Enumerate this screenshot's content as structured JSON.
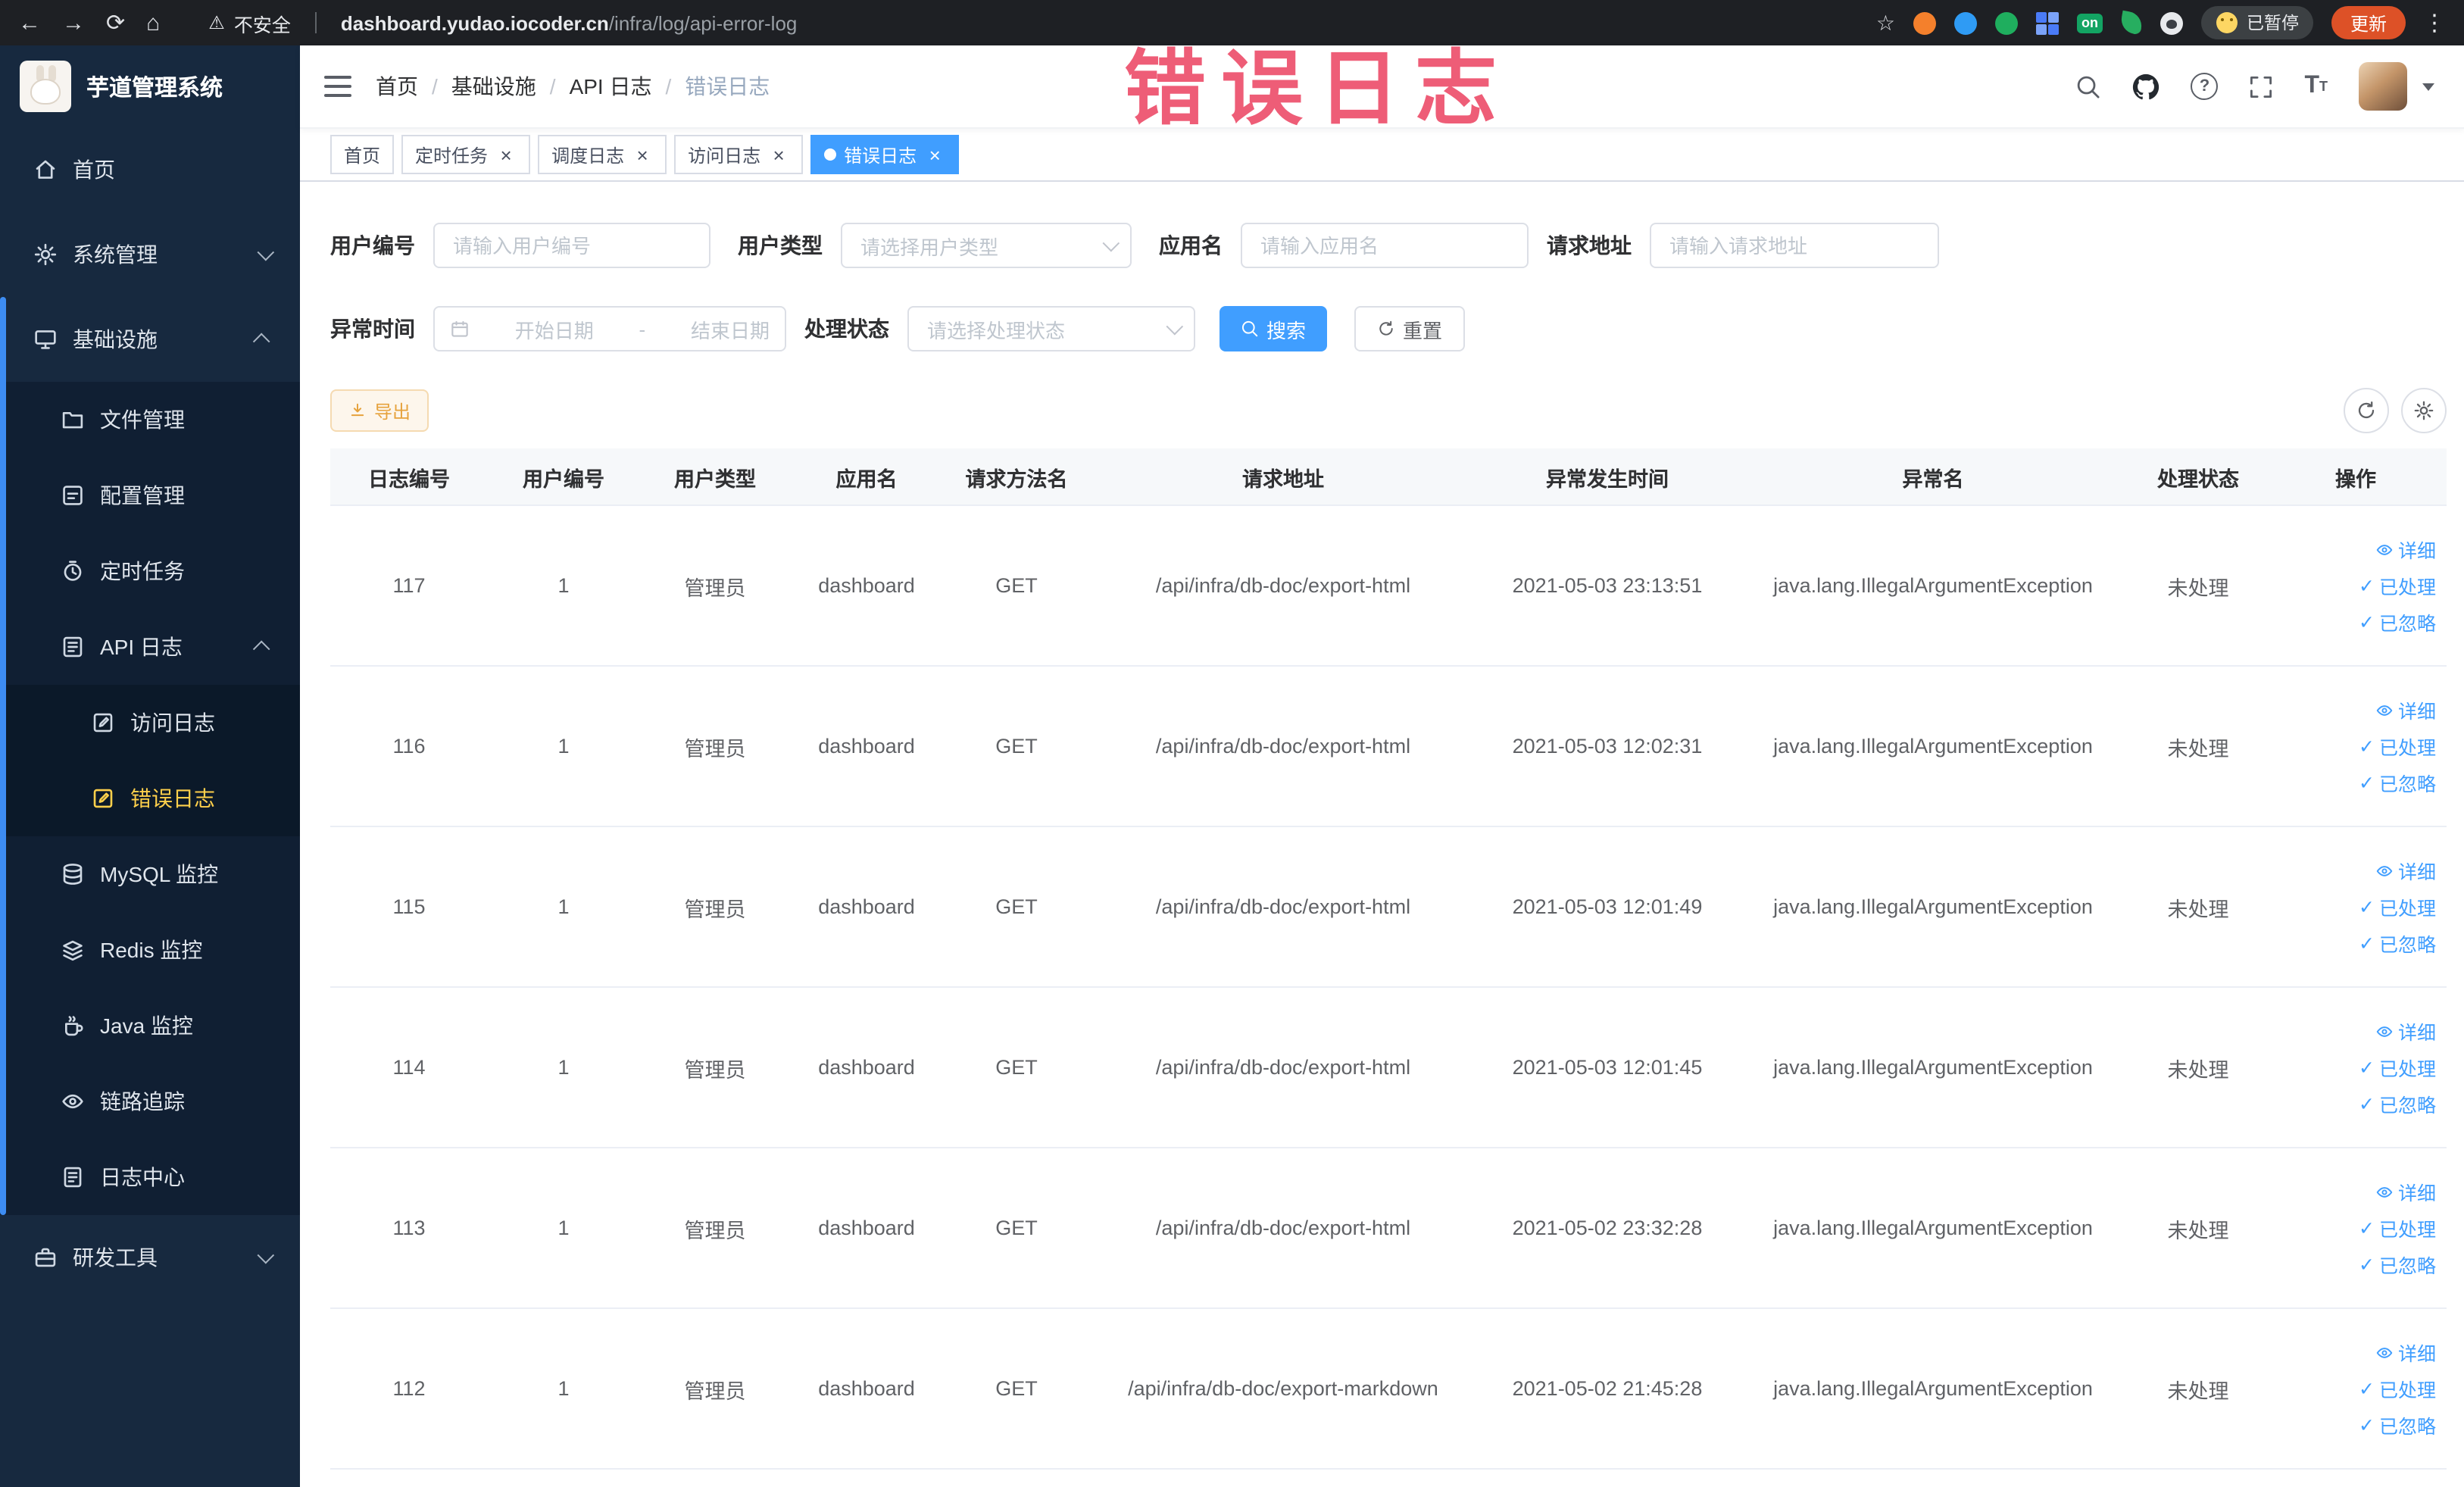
{
  "colors": {
    "accent": "#409eff",
    "sidebar_active": "#ffd04b",
    "warning": "#e6a23c",
    "annotation": "#ee5570"
  },
  "annotation": {
    "text": "错误日志"
  },
  "browser": {
    "security_label": "不安全",
    "url_domain": "dashboard.yudao.iocoder.cn",
    "url_path": "/infra/log/api-error-log",
    "paused_badge": "已暂停",
    "update_button": "更新"
  },
  "sidebar": {
    "logo_title": "芋道管理系统",
    "items": [
      {
        "label": "首页",
        "icon": "home-icon",
        "level": 1
      },
      {
        "label": "系统管理",
        "icon": "gear-icon",
        "level": 1,
        "expandable": true,
        "expanded": false
      },
      {
        "label": "基础设施",
        "icon": "monitor-icon",
        "level": 1,
        "expandable": true,
        "expanded": true
      },
      {
        "label": "文件管理",
        "icon": "folder-icon",
        "level": 2
      },
      {
        "label": "配置管理",
        "icon": "config-icon",
        "level": 2
      },
      {
        "label": "定时任务",
        "icon": "timer-icon",
        "level": 2
      },
      {
        "label": "API 日志",
        "icon": "log-icon",
        "level": 2,
        "expandable": true,
        "expanded": true
      },
      {
        "label": "访问日志",
        "icon": "doc-edit-icon",
        "level": 3
      },
      {
        "label": "错误日志",
        "icon": "doc-edit-icon",
        "level": 3,
        "active": true
      },
      {
        "label": "MySQL 监控",
        "icon": "database-icon",
        "level": 2
      },
      {
        "label": "Redis 监控",
        "icon": "redis-icon",
        "level": 2
      },
      {
        "label": "Java 监控",
        "icon": "java-icon",
        "level": 2
      },
      {
        "label": "链路追踪",
        "icon": "trace-icon",
        "level": 2
      },
      {
        "label": "日志中心",
        "icon": "log-center-icon",
        "level": 2
      },
      {
        "label": "研发工具",
        "icon": "tools-icon",
        "level": 1,
        "expandable": true,
        "expanded": false
      }
    ]
  },
  "header": {
    "breadcrumb": [
      "首页",
      "基础设施",
      "API 日志",
      "错误日志"
    ]
  },
  "tabs": [
    {
      "label": "首页",
      "closable": false,
      "active": false
    },
    {
      "label": "定时任务",
      "closable": true,
      "active": false
    },
    {
      "label": "调度日志",
      "closable": true,
      "active": false
    },
    {
      "label": "访问日志",
      "closable": true,
      "active": false
    },
    {
      "label": "错误日志",
      "closable": true,
      "active": true
    }
  ],
  "filters": {
    "user_id": {
      "label": "用户编号",
      "placeholder": "请输入用户编号"
    },
    "user_type": {
      "label": "用户类型",
      "placeholder": "请选择用户类型"
    },
    "app_name": {
      "label": "应用名",
      "placeholder": "请输入应用名"
    },
    "request_url": {
      "label": "请求地址",
      "placeholder": "请输入请求地址"
    },
    "exception_time": {
      "label": "异常时间",
      "start_placeholder": "开始日期",
      "separator": "-",
      "end_placeholder": "结束日期"
    },
    "process_status": {
      "label": "处理状态",
      "placeholder": "请选择处理状态"
    },
    "search_button": "搜索",
    "reset_button": "重置"
  },
  "toolbar": {
    "export_button": "导出"
  },
  "table": {
    "columns": [
      "日志编号",
      "用户编号",
      "用户类型",
      "应用名",
      "请求方法名",
      "请求地址",
      "异常发生时间",
      "异常名",
      "处理状态",
      "操作"
    ],
    "action_labels": {
      "detail": "详细",
      "processed": "已处理",
      "ignored": "已忽略"
    },
    "rows": [
      {
        "id": "117",
        "user_id": "1",
        "user_type": "管理员",
        "app": "dashboard",
        "method": "GET",
        "url": "/api/infra/db-doc/export-html",
        "time": "2021-05-03 23:13:51",
        "exception": "java.lang.IllegalArgumentException",
        "status": "未处理"
      },
      {
        "id": "116",
        "user_id": "1",
        "user_type": "管理员",
        "app": "dashboard",
        "method": "GET",
        "url": "/api/infra/db-doc/export-html",
        "time": "2021-05-03 12:02:31",
        "exception": "java.lang.IllegalArgumentException",
        "status": "未处理"
      },
      {
        "id": "115",
        "user_id": "1",
        "user_type": "管理员",
        "app": "dashboard",
        "method": "GET",
        "url": "/api/infra/db-doc/export-html",
        "time": "2021-05-03 12:01:49",
        "exception": "java.lang.IllegalArgumentException",
        "status": "未处理"
      },
      {
        "id": "114",
        "user_id": "1",
        "user_type": "管理员",
        "app": "dashboard",
        "method": "GET",
        "url": "/api/infra/db-doc/export-html",
        "time": "2021-05-03 12:01:45",
        "exception": "java.lang.IllegalArgumentException",
        "status": "未处理"
      },
      {
        "id": "113",
        "user_id": "1",
        "user_type": "管理员",
        "app": "dashboard",
        "method": "GET",
        "url": "/api/infra/db-doc/export-html",
        "time": "2021-05-02 23:32:28",
        "exception": "java.lang.IllegalArgumentException",
        "status": "未处理"
      },
      {
        "id": "112",
        "user_id": "1",
        "user_type": "管理员",
        "app": "dashboard",
        "method": "GET",
        "url": "/api/infra/db-doc/export-markdown",
        "time": "2021-05-02 21:45:28",
        "exception": "java.lang.IllegalArgumentException",
        "status": "未处理"
      }
    ]
  }
}
